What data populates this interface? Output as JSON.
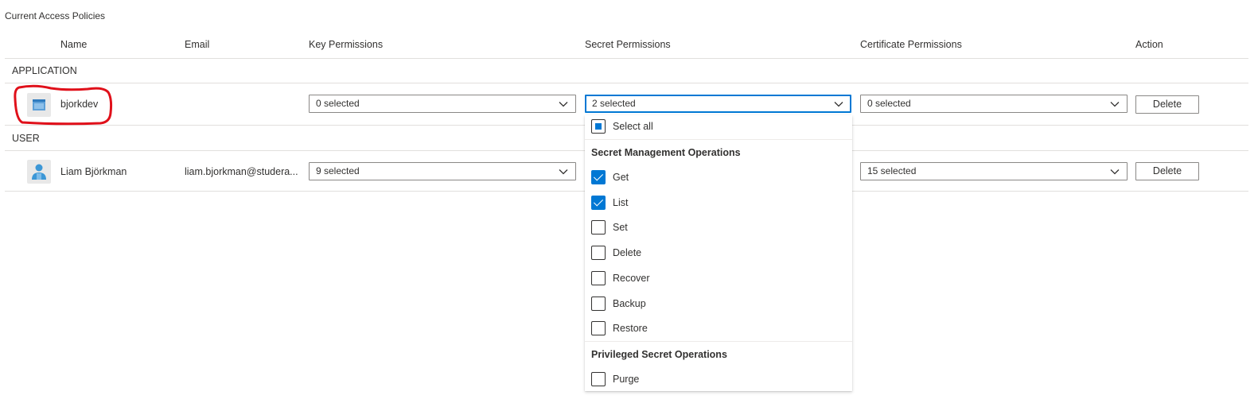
{
  "page": {
    "title": "Current Access Policies"
  },
  "columns": {
    "name": "Name",
    "email": "Email",
    "key": "Key Permissions",
    "secret": "Secret Permissions",
    "certificate": "Certificate Permissions",
    "action": "Action"
  },
  "groups": {
    "application": "APPLICATION",
    "user": "USER"
  },
  "rows": [
    {
      "name": "bjorkdev",
      "email": "",
      "icon": "app-icon",
      "key": "0 selected",
      "secret": "2 selected",
      "certificate": "0 selected",
      "action": "Delete"
    },
    {
      "name": "Liam Björkman",
      "email": "liam.bjorkman@studera...",
      "icon": "user-icon",
      "key": "9 selected",
      "secret": "",
      "certificate": "15 selected",
      "action": "Delete"
    }
  ],
  "dropdown_panel": {
    "select_all": "Select all",
    "sections": [
      {
        "title": "Secret Management Operations",
        "options": [
          {
            "label": "Get",
            "checked": true
          },
          {
            "label": "List",
            "checked": true
          },
          {
            "label": "Set",
            "checked": false
          },
          {
            "label": "Delete",
            "checked": false
          },
          {
            "label": "Recover",
            "checked": false
          },
          {
            "label": "Backup",
            "checked": false
          },
          {
            "label": "Restore",
            "checked": false
          }
        ]
      },
      {
        "title": "Privileged Secret Operations",
        "options": [
          {
            "label": "Purge",
            "checked": false
          }
        ]
      }
    ]
  },
  "colors": {
    "accent": "#0078d4",
    "annotation": "#e0101a",
    "border": "#8a8886",
    "divider": "#e1dfdd"
  }
}
